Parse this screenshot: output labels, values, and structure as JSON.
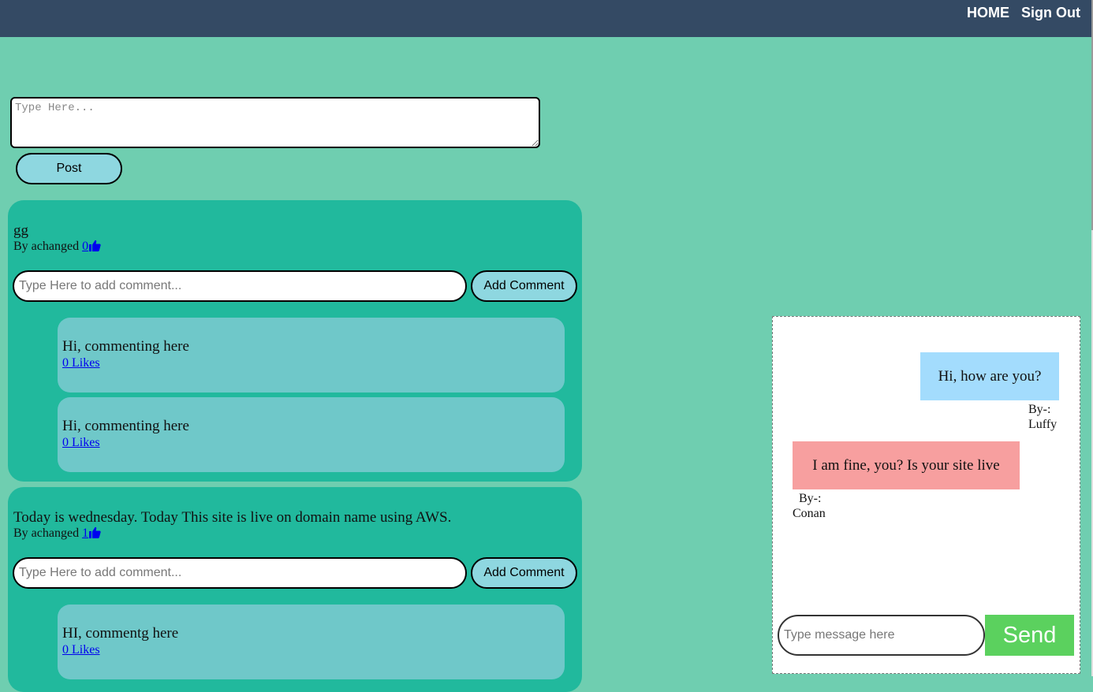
{
  "nav": {
    "home": "HOME",
    "signout": "Sign Out"
  },
  "composer": {
    "placeholder": "Type Here...",
    "post_label": "Post"
  },
  "posts": [
    {
      "text": "gg",
      "author_prefix": "By achanged",
      "likes": "0",
      "comment_placeholder": "Type Here to add comment...",
      "add_comment_label": "Add Comment",
      "comments": [
        {
          "text": "Hi, commenting here",
          "likes": "0 Likes"
        },
        {
          "text": "Hi, commenting here",
          "likes": "0 Likes"
        }
      ]
    },
    {
      "text": "Today is wednesday. Today This site is live on domain name using AWS.",
      "author_prefix": "By achanged",
      "likes": "1",
      "comment_placeholder": "Type Here to add comment...",
      "add_comment_label": "Add Comment",
      "comments": [
        {
          "text": "HI, commentg here",
          "likes": "0 Likes"
        }
      ]
    }
  ],
  "chat": {
    "messages": [
      {
        "text": "Hi, how are you?",
        "by_label": "By-:",
        "by_name": "Luffy"
      },
      {
        "text": "I am fine, you? Is your site live",
        "by_label": "By-:",
        "by_name": "Conan"
      }
    ],
    "input_placeholder": "Type message here",
    "send_label": "Send"
  },
  "colors": {
    "background": "#6fceb0",
    "topbar": "#344a64",
    "post_card": "#21b99d",
    "comment_card": "#6fc8c9",
    "button": "#8ed7e0",
    "sent_bubble": "#a3dcfd",
    "received_bubble": "#f79f9f",
    "send_button": "#5bd15e"
  }
}
